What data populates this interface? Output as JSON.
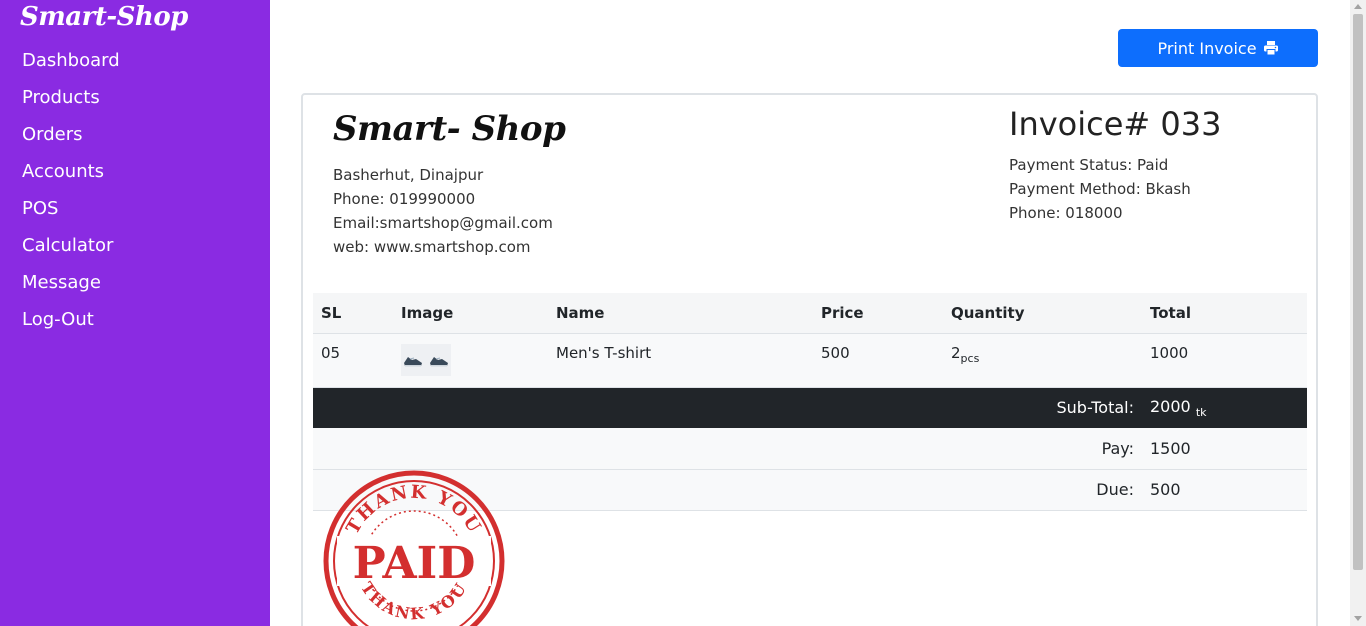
{
  "sidebar": {
    "brand": "Smart-Shop",
    "items": [
      {
        "label": "Dashboard"
      },
      {
        "label": "Products"
      },
      {
        "label": "Orders"
      },
      {
        "label": "Accounts"
      },
      {
        "label": "POS"
      },
      {
        "label": "Calculator"
      },
      {
        "label": "Message"
      },
      {
        "label": "Log-Out"
      }
    ],
    "bg_color": "#8a2be2"
  },
  "toolbar": {
    "print_label": "Print Invoice",
    "print_icon": "printer-icon",
    "button_color": "#0d6efd"
  },
  "shop": {
    "name": "Smart- Shop",
    "address": "Basherhut, Dinajpur",
    "phone": "Phone: 019990000",
    "email": "Email:smartshop@gmail.com",
    "web": "web: www.smartshop.com"
  },
  "invoice": {
    "title": "Invoice# 033",
    "payment_status": "Payment Status: Paid",
    "payment_method": "Payment Method: Bkash",
    "phone": "Phone: 018000"
  },
  "table": {
    "headers": [
      "SL",
      "Image",
      "Name",
      "Price",
      "Quantity",
      "Total"
    ],
    "rows": [
      {
        "sl": "05",
        "image": "shoes-image",
        "name": "Men's T-shirt",
        "price": "500",
        "quantity": "2",
        "quantity_unit": "pcs",
        "total": "1000"
      }
    ],
    "subtotal_label": "Sub-Total:",
    "subtotal_value": "2000",
    "subtotal_unit": "tk",
    "pay_label": "Pay:",
    "pay_value": "1500",
    "due_label": "Due:",
    "due_value": "500"
  },
  "stamp": {
    "top_text": "THANK YOU",
    "center_text": "PAID",
    "bottom_text": "THANK YOU",
    "color": "#d32f2f"
  }
}
